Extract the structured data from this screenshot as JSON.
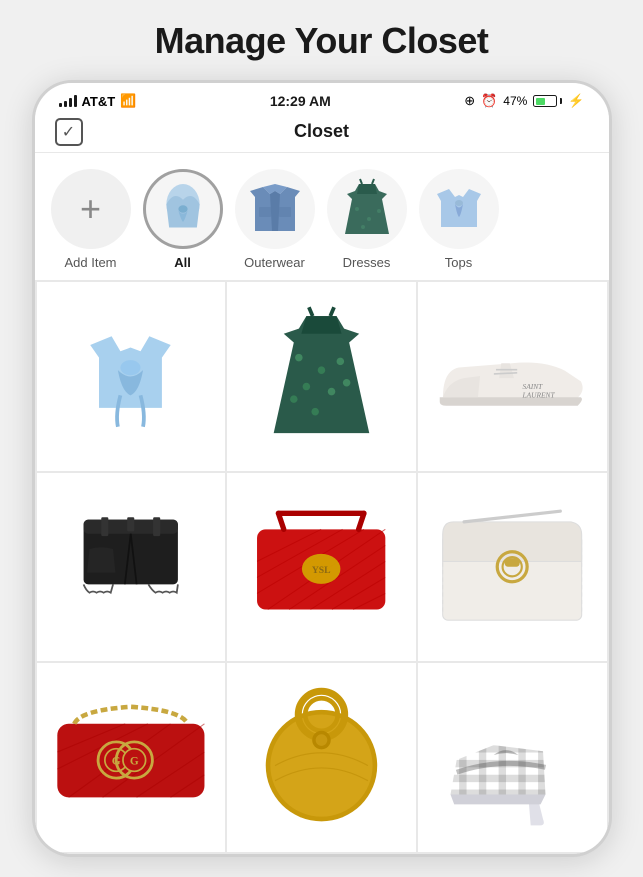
{
  "page": {
    "title": "Manage Your Closet"
  },
  "status_bar": {
    "carrier": "AT&T",
    "time": "12:29 AM",
    "battery_percent": "47%"
  },
  "nav": {
    "title": "Closet"
  },
  "categories": [
    {
      "id": "add",
      "label": "Add Item",
      "type": "add"
    },
    {
      "id": "all",
      "label": "All",
      "type": "selected",
      "emoji": "👚"
    },
    {
      "id": "outerwear",
      "label": "Outerwear",
      "type": "normal",
      "emoji": "🧥"
    },
    {
      "id": "dresses",
      "label": "Dresses",
      "type": "normal",
      "emoji": "👗"
    },
    {
      "id": "tops",
      "label": "Tops",
      "type": "normal",
      "emoji": "👕"
    }
  ],
  "grid_items": [
    {
      "id": "item1",
      "name": "Blue Tie-Front Crop Top",
      "color": "#a8c8e8"
    },
    {
      "id": "item2",
      "name": "Floral Midi Dress",
      "color": "#3a6b5c"
    },
    {
      "id": "item3",
      "name": "White Sneakers",
      "color": "#f5f5f5"
    },
    {
      "id": "item4",
      "name": "Black Denim Shorts",
      "color": "#2a2a2a"
    },
    {
      "id": "item5",
      "name": "Red YSL Clutch",
      "color": "#cc2222"
    },
    {
      "id": "item6",
      "name": "White Chloe Bag",
      "color": "#e8e8e0"
    },
    {
      "id": "item7",
      "name": "Red Gucci Mini Bag",
      "color": "#bb1111"
    },
    {
      "id": "item8",
      "name": "Yellow Round Bag",
      "color": "#d4a800"
    },
    {
      "id": "item9",
      "name": "Gingham Heels",
      "color": "#f5f5f5"
    }
  ]
}
